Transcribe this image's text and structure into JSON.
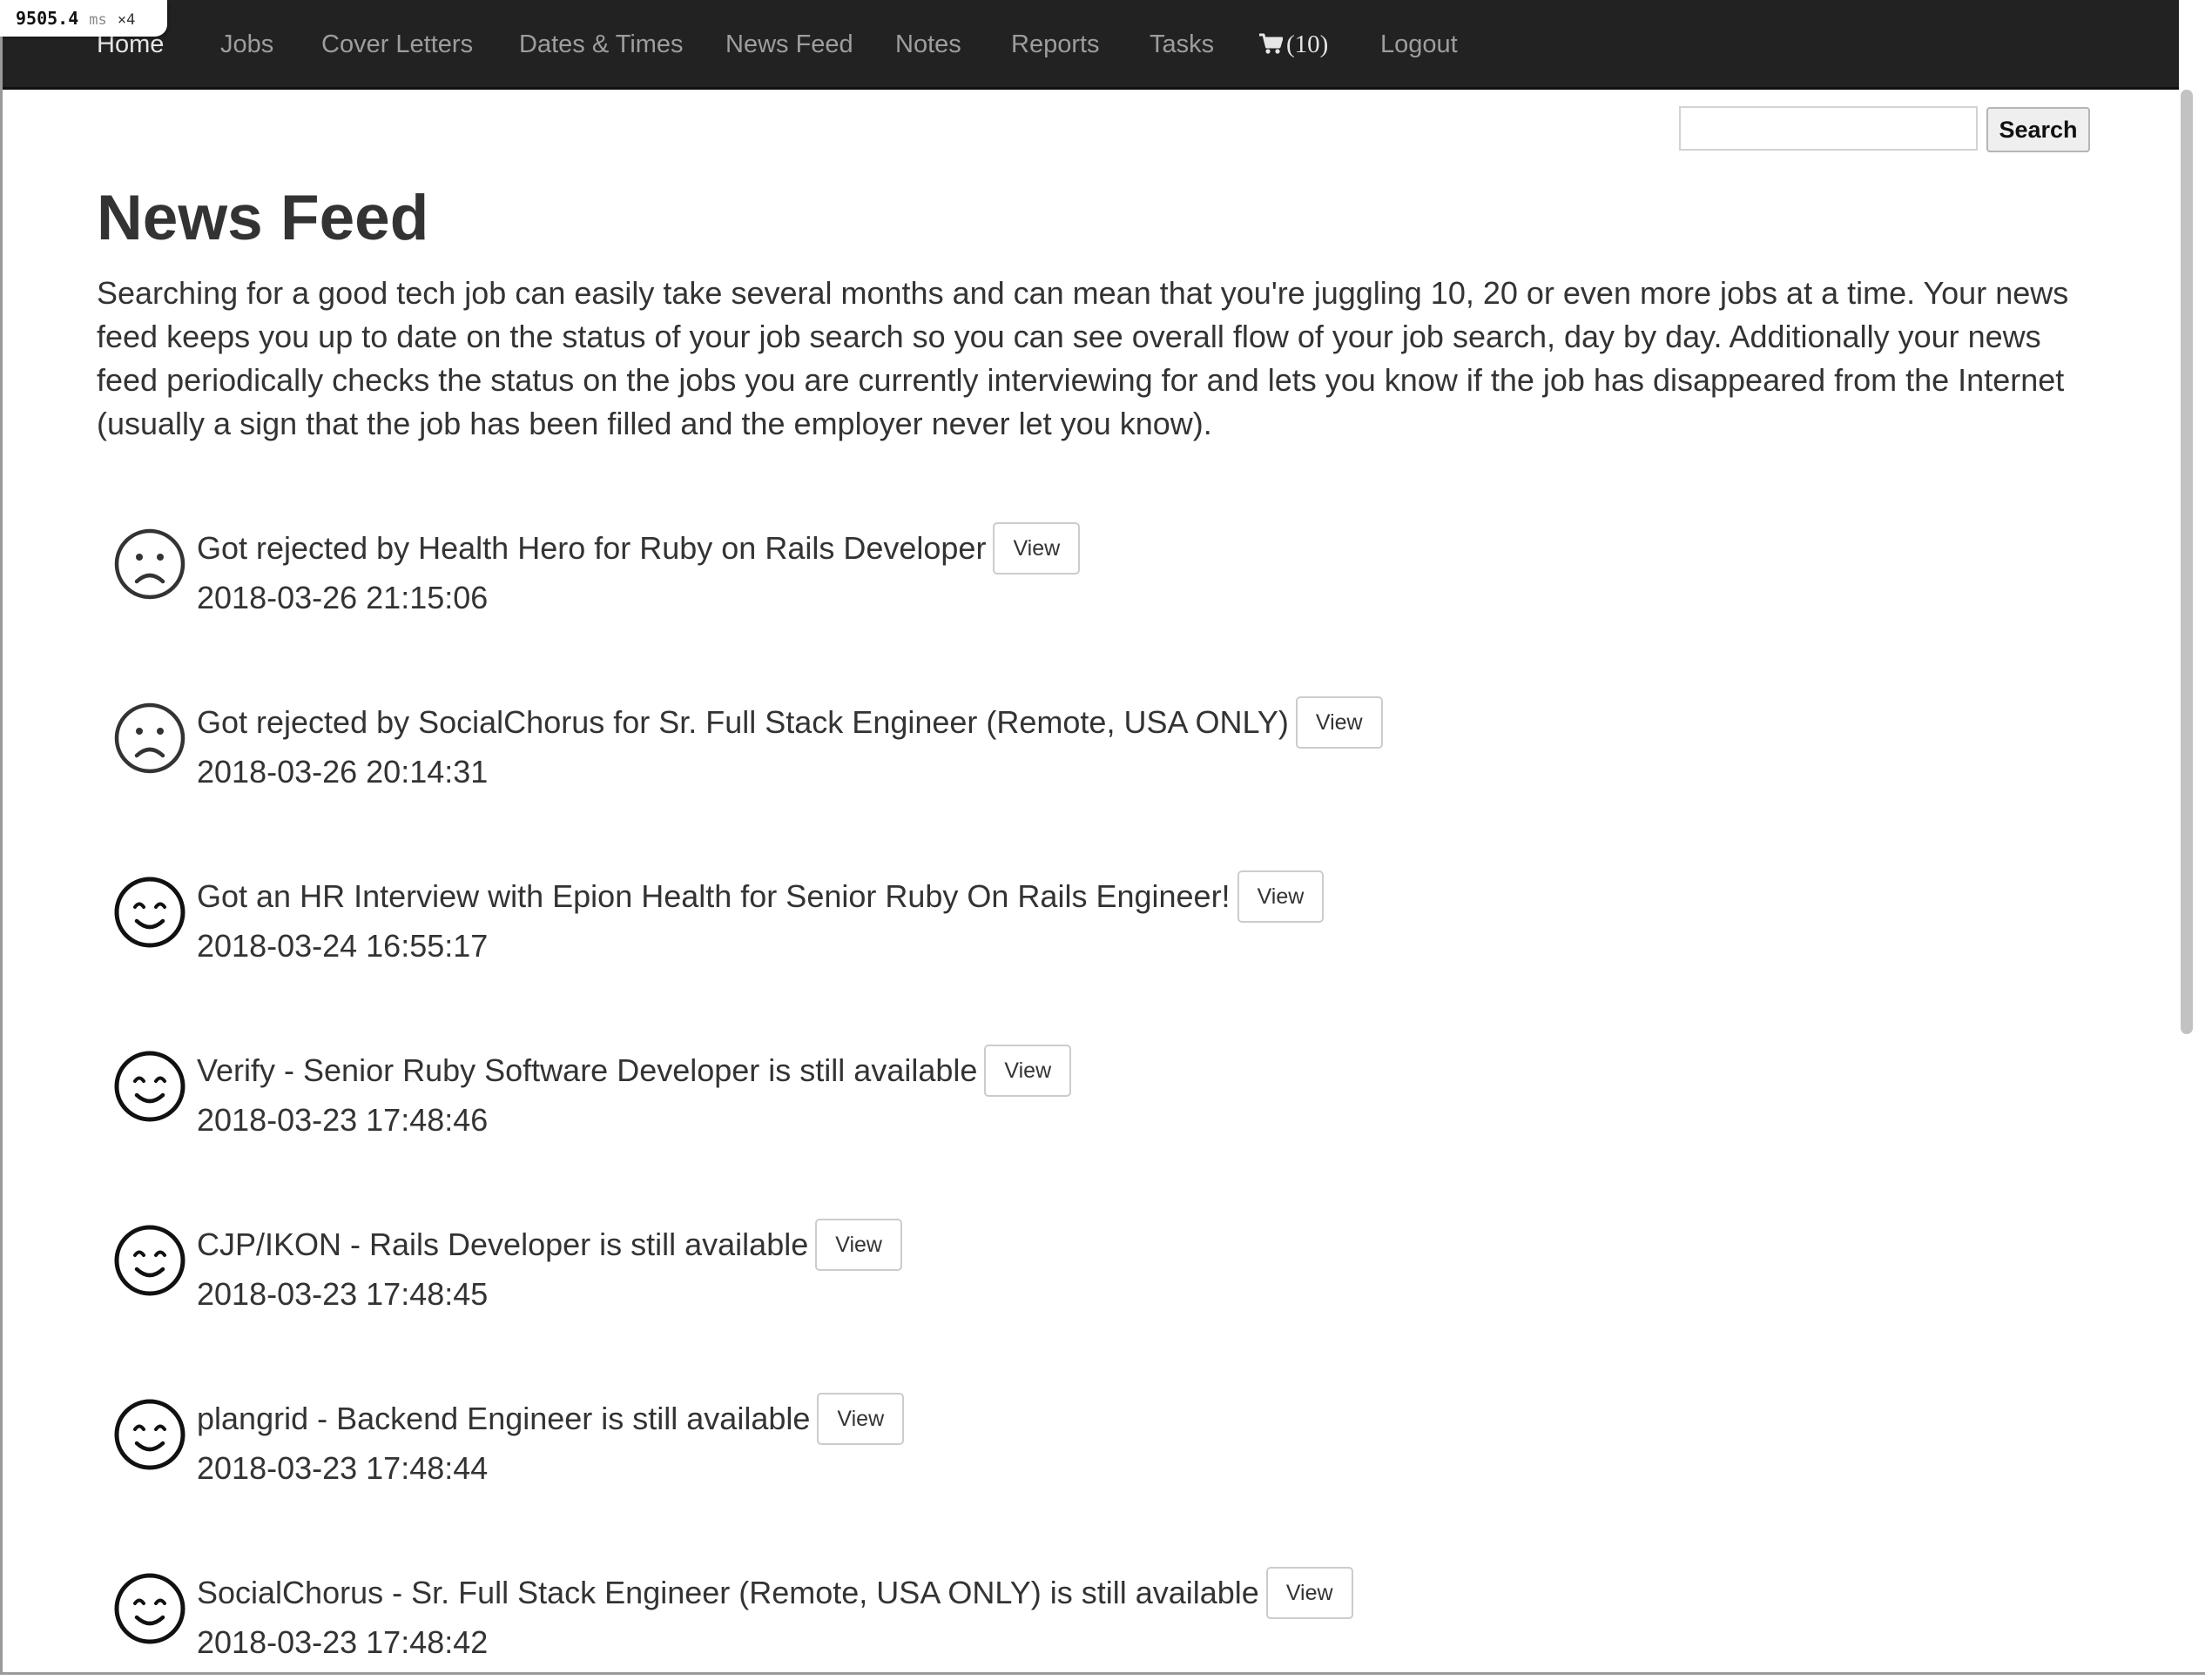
{
  "perf_overlay": {
    "value": "9505.4",
    "unit": "ms",
    "multiplier": "×4"
  },
  "nav": {
    "items": [
      {
        "label": "Home",
        "active": true
      },
      {
        "label": "Jobs"
      },
      {
        "label": "Cover Letters"
      },
      {
        "label": "Dates & Times"
      },
      {
        "label": "News Feed"
      },
      {
        "label": "Notes"
      },
      {
        "label": "Reports"
      },
      {
        "label": "Tasks"
      },
      {
        "label": "(10)",
        "icon": "shopping-cart-icon"
      },
      {
        "label": "Logout"
      }
    ]
  },
  "search": {
    "value": "",
    "button_label": "Search"
  },
  "page": {
    "title": "News Feed",
    "intro": "Searching for a good tech job can easily take several months and can mean that you're juggling 10, 20 or even more jobs at a time. Your news feed keeps you up to date on the status of your job search so you can see overall flow of your job search, day by day. Additionally your news feed periodically checks the status on the jobs you are currently interviewing for and lets you know if the job has disappeared from the Internet (usually a sign that the job has been filled and the employer never let you know)."
  },
  "feed": {
    "items": [
      {
        "icon": "frown-face-icon",
        "message": "Got rejected by Health Hero for Ruby on Rails Developer",
        "button_label": "View",
        "timestamp": "2018-03-26 21:15:06"
      },
      {
        "icon": "frown-face-icon",
        "message": "Got rejected by SocialChorus for Sr. Full Stack Engineer (Remote, USA ONLY)",
        "button_label": "View",
        "timestamp": "2018-03-26 20:14:31"
      },
      {
        "icon": "smiley-face-icon",
        "message": "Got an HR Interview with Epion Health for Senior Ruby On Rails Engineer!",
        "button_label": "View",
        "timestamp": "2018-03-24 16:55:17"
      },
      {
        "icon": "smiley-face-icon",
        "message": "Verify - Senior Ruby Software Developer is still available",
        "button_label": "View",
        "timestamp": "2018-03-23 17:48:46"
      },
      {
        "icon": "smiley-face-icon",
        "message": "CJP/IKON - Rails Developer is still available",
        "button_label": "View",
        "timestamp": "2018-03-23 17:48:45"
      },
      {
        "icon": "smiley-face-icon",
        "message": "plangrid - Backend Engineer is still available",
        "button_label": "View",
        "timestamp": "2018-03-23 17:48:44"
      },
      {
        "icon": "smiley-face-icon",
        "message": "SocialChorus - Sr. Full Stack Engineer (Remote, USA ONLY) is still available",
        "button_label": "View",
        "timestamp": "2018-03-23 17:48:42"
      }
    ]
  }
}
